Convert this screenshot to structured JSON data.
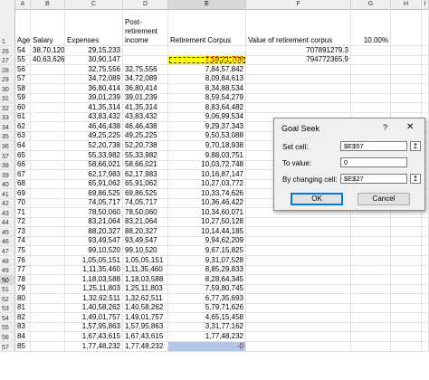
{
  "columns": [
    "A",
    "B",
    "C",
    "D",
    "E",
    "F",
    "G",
    "H",
    "I"
  ],
  "selected_column": "E",
  "header_row": {
    "row_num": "1",
    "age": "Age",
    "salary": "Salary",
    "expenses": "Expenses",
    "post_retirement": "Post-retirement income",
    "corpus": "Retirement Corpus",
    "value_corpus": "Value of retirement corpus",
    "rate": "10.00%"
  },
  "rows": [
    {
      "n": "26",
      "a": "54",
      "b": "38,70,120",
      "c": "29,15,233",
      "d": "",
      "e": "",
      "f": "707891279.3"
    },
    {
      "n": "27",
      "a": "55",
      "b": "40,63,626",
      "c": "30,90,147",
      "d": "",
      "e": "7,59,21,706",
      "f": "794772365.9"
    },
    {
      "n": "28",
      "a": "56",
      "b": "",
      "c": "32,75,556",
      "d": "32,75,556",
      "e": "7,84,57,842",
      "f": ""
    },
    {
      "n": "29",
      "a": "57",
      "b": "",
      "c": "34,72,089",
      "d": "34,72,089",
      "e": "8,09,84,613",
      "f": ""
    },
    {
      "n": "30",
      "a": "58",
      "b": "",
      "c": "36,80,414",
      "d": "36,80,414",
      "e": "8,34,88,534",
      "f": ""
    },
    {
      "n": "31",
      "a": "59",
      "b": "",
      "c": "39,01,239",
      "d": "39,01,239",
      "e": "8,59,54,279",
      "f": ""
    },
    {
      "n": "32",
      "a": "60",
      "b": "",
      "c": "41,35,314",
      "d": "41,35,314",
      "e": "8,83,64,482",
      "f": ""
    },
    {
      "n": "33",
      "a": "61",
      "b": "",
      "c": "43,83,432",
      "d": "43,83,432",
      "e": "9,06,99,534",
      "f": ""
    },
    {
      "n": "34",
      "a": "62",
      "b": "",
      "c": "46,46,438",
      "d": "46,46,438",
      "e": "9,29,37,343",
      "f": ""
    },
    {
      "n": "35",
      "a": "63",
      "b": "",
      "c": "49,25,225",
      "d": "49,25,225",
      "e": "9,50,53,088",
      "f": ""
    },
    {
      "n": "36",
      "a": "64",
      "b": "",
      "c": "52,20,738",
      "d": "52,20,738",
      "e": "9,70,18,938",
      "f": ""
    },
    {
      "n": "37",
      "a": "65",
      "b": "",
      "c": "55,33,982",
      "d": "55,33,982",
      "e": "9,88,03,751",
      "f": ""
    },
    {
      "n": "38",
      "a": "66",
      "b": "",
      "c": "58,66,021",
      "d": "58,66,021",
      "e": "10,03,72,748",
      "f": ""
    },
    {
      "n": "39",
      "a": "67",
      "b": "",
      "c": "62,17,983",
      "d": "62,17,983",
      "e": "10,16,87,147",
      "f": ""
    },
    {
      "n": "40",
      "a": "68",
      "b": "",
      "c": "65,91,062",
      "d": "65,91,062",
      "e": "10,27,03,772",
      "f": ""
    },
    {
      "n": "41",
      "a": "69",
      "b": "",
      "c": "69,86,525",
      "d": "69,86,525",
      "e": "10,33,74,626",
      "f": ""
    },
    {
      "n": "42",
      "a": "70",
      "b": "",
      "c": "74,05,717",
      "d": "74,05,717",
      "e": "10,36,46,422",
      "f": ""
    },
    {
      "n": "43",
      "a": "71",
      "b": "",
      "c": "78,50,060",
      "d": "78,50,060",
      "e": "10,34,60,071",
      "f": ""
    },
    {
      "n": "44",
      "a": "72",
      "b": "",
      "c": "83,21,064",
      "d": "83,21,064",
      "e": "10,27,50,128",
      "f": ""
    },
    {
      "n": "45",
      "a": "73",
      "b": "",
      "c": "88,20,327",
      "d": "88,20,327",
      "e": "10,14,44,185",
      "f": ""
    },
    {
      "n": "46",
      "a": "74",
      "b": "",
      "c": "93,49,547",
      "d": "93,49,547",
      "e": "9,94,62,209",
      "f": ""
    },
    {
      "n": "47",
      "a": "75",
      "b": "",
      "c": "99,10,520",
      "d": "99,10,520",
      "e": "9,67,15,825",
      "f": ""
    },
    {
      "n": "48",
      "a": "76",
      "b": "",
      "c": "1,05,05,151",
      "d": "1,05,05,151",
      "e": "9,31,07,528",
      "f": ""
    },
    {
      "n": "49",
      "a": "77",
      "b": "",
      "c": "1,11,35,460",
      "d": "1,11,35,460",
      "e": "8,85,29,833",
      "f": ""
    },
    {
      "n": "50",
      "a": "78",
      "b": "",
      "c": "1,18,03,588",
      "d": "1,18,03,588",
      "e": "8,28,64,345",
      "f": ""
    },
    {
      "n": "51",
      "a": "79",
      "b": "",
      "c": "1,25,11,803",
      "d": "1,25,11,803",
      "e": "7,59,80,745",
      "f": ""
    },
    {
      "n": "52",
      "a": "80",
      "b": "",
      "c": "1,32,62,511",
      "d": "1,32,62,511",
      "e": "6,77,35,693",
      "f": ""
    },
    {
      "n": "53",
      "a": "81",
      "b": "",
      "c": "1,40,58,262",
      "d": "1,40,58,262",
      "e": "5,79,71,626",
      "f": ""
    },
    {
      "n": "54",
      "a": "82",
      "b": "",
      "c": "1,49,01,757",
      "d": "1,49,01,757",
      "e": "4,65,15,458",
      "f": ""
    },
    {
      "n": "55",
      "a": "83",
      "b": "",
      "c": "1,57,95,863",
      "d": "1,57,95,863",
      "e": "3,31,77,162",
      "f": ""
    },
    {
      "n": "56",
      "a": "84",
      "b": "",
      "c": "1,67,43,615",
      "d": "1,67,43,615",
      "e": "1,77,48,232",
      "f": ""
    },
    {
      "n": "57",
      "a": "85",
      "b": "",
      "c": "1,77,48,232",
      "d": "1,77,48,232",
      "e": "-0",
      "f": ""
    }
  ],
  "dialog": {
    "title": "Goal Seek",
    "help": "?",
    "close": "✕",
    "set_cell_label": "Set cell:",
    "set_cell_value": "$E$57",
    "to_value_label": "To value:",
    "to_value_value": "0",
    "by_changing_label": "By changing cell:",
    "by_changing_value": "$E$27",
    "ok": "OK",
    "cancel": "Cancel",
    "picker_icon": "↥"
  },
  "colors": {
    "highlight_yellow": "#ffff00",
    "active_cell": "#b4c6e7",
    "negative_red": "#c00000"
  }
}
